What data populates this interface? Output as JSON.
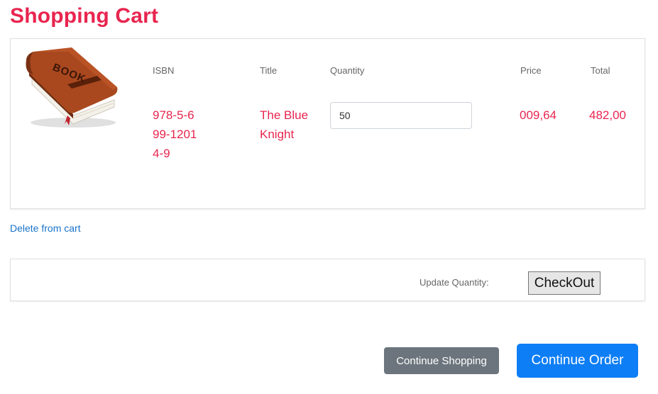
{
  "page": {
    "title": "Shopping Cart"
  },
  "columns": {
    "isbn": "ISBN",
    "title": "Title",
    "quantity": "Quantity",
    "price": "Price",
    "total": "Total"
  },
  "cart_item": {
    "image_icon": "book-icon",
    "image_text": "BOOK",
    "isbn": "978-5-699-12014-9",
    "title": "The Blue Knight",
    "quantity": "50",
    "price": "009,64",
    "total": "482,00"
  },
  "actions": {
    "delete_label": "Delete from cart",
    "update_quantity_label": "Update Quantity:",
    "checkout_label": "CheckOut",
    "continue_shopping_label": "Continue Shopping",
    "continue_order_label": "Continue Order"
  },
  "colors": {
    "accent": "#e8254f",
    "link": "#1a73c9",
    "primary_button": "#0d7ef5",
    "secondary_button": "#6c757d"
  }
}
